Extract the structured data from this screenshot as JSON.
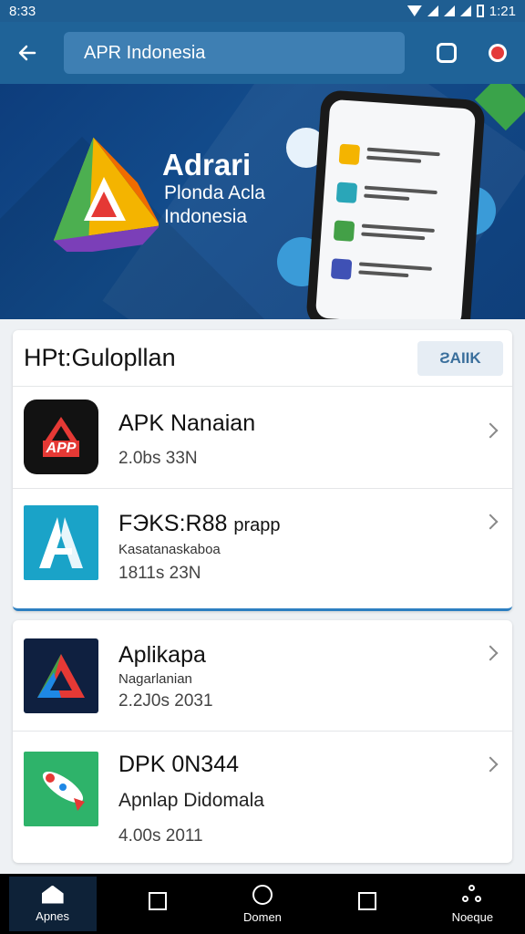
{
  "status_bar": {
    "time": "8:33",
    "clock": "1:21"
  },
  "header": {
    "search_value": "APR Indonesia"
  },
  "banner": {
    "title": "Adrari",
    "subtitle_line1": "Plonda Acla",
    "subtitle_line2": "Indonesia"
  },
  "section": {
    "title": "HPt:Gulopllan",
    "see_all_label": "ƧAIIK"
  },
  "apps": [
    {
      "name": "APK Nanaian",
      "desc": "",
      "meta": "2.0bs 33N",
      "icon_label": "APP",
      "icon": "app-logo-icon"
    },
    {
      "name": "FЭKS:R88",
      "name_suffix": "prapp",
      "desc": "Kasatanaskaboa",
      "meta": "1811s 23N",
      "icon": "a-logo-icon"
    },
    {
      "name": "Aplikapa",
      "desc": "Nagarlanian",
      "meta": "2.2J0s 2031",
      "icon": "triangle-logo-icon"
    },
    {
      "name": "DPK 0N344",
      "desc": "Apnlap Didomala",
      "meta": "4.00s 2011",
      "icon": "rocket-logo-icon"
    }
  ],
  "nav": [
    {
      "label": "Apnes",
      "icon": "home-icon",
      "active": true
    },
    {
      "label": "",
      "icon": "square-icon",
      "active": false
    },
    {
      "label": "Domen",
      "icon": "circle-icon",
      "active": false
    },
    {
      "label": "",
      "icon": "square-icon",
      "active": false
    },
    {
      "label": "Noeque",
      "icon": "network-icon",
      "active": false
    }
  ],
  "colors": {
    "app_bar": "#1f6398",
    "banner": "#134c8c",
    "accent": "#2d7fc1"
  }
}
